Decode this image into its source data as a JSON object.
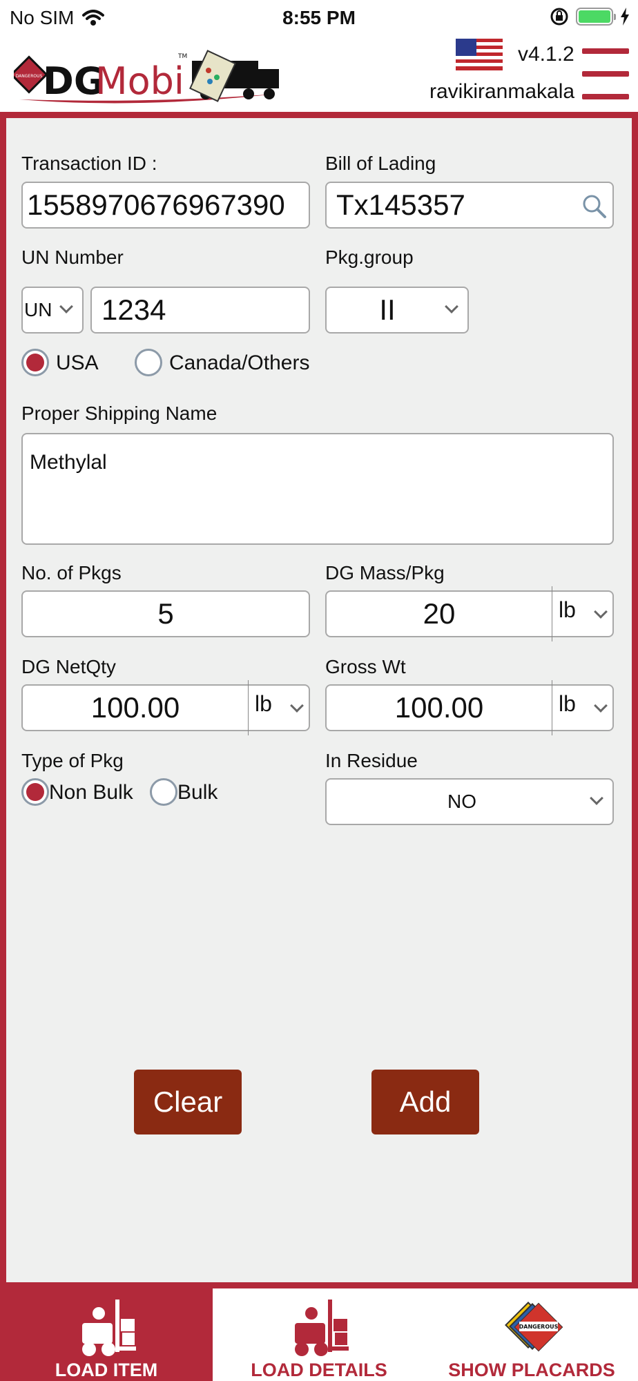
{
  "status_bar": {
    "carrier": "No SIM",
    "time": "8:55 PM"
  },
  "header": {
    "logo_text": "DGMobi",
    "logo_badge": "DANGEROUS",
    "version": "v4.1.2",
    "username": "ravikiranmakala"
  },
  "form": {
    "transaction_id": {
      "label": "Transaction ID :",
      "value": "1558970676967390"
    },
    "bill_of_lading": {
      "label": "Bill of Lading",
      "value": "Tx145357"
    },
    "un_number": {
      "label": "UN Number",
      "prefix": "UN",
      "value": "1234"
    },
    "pkg_group": {
      "label": "Pkg.group",
      "value": "II"
    },
    "region": {
      "options": [
        "USA",
        "Canada/Others"
      ],
      "selected": "USA"
    },
    "proper_shipping_name": {
      "label": "Proper Shipping Name",
      "value": "Methylal"
    },
    "no_of_pkgs": {
      "label": "No. of Pkgs",
      "value": "5"
    },
    "dg_mass_pkg": {
      "label": "DG Mass/Pkg",
      "value": "20",
      "unit": "lb"
    },
    "dg_net_qty": {
      "label": "DG NetQty",
      "value": "100.00",
      "unit": "lb"
    },
    "gross_wt": {
      "label": "Gross Wt",
      "value": "100.00",
      "unit": "lb"
    },
    "type_of_pkg": {
      "label": "Type of Pkg",
      "options": [
        "Non Bulk",
        "Bulk"
      ],
      "selected": "Non Bulk"
    },
    "in_residue": {
      "label": "In Residue",
      "value": "NO"
    }
  },
  "buttons": {
    "clear": "Clear",
    "add": "Add"
  },
  "tabs": [
    {
      "label": "LOAD ITEM",
      "active": true
    },
    {
      "label": "LOAD DETAILS",
      "active": false
    },
    {
      "label": "SHOW PLACARDS",
      "active": false
    }
  ],
  "colors": {
    "brand": "#b2293a",
    "button": "#8a2a12",
    "panel_bg": "#eff0ef"
  }
}
